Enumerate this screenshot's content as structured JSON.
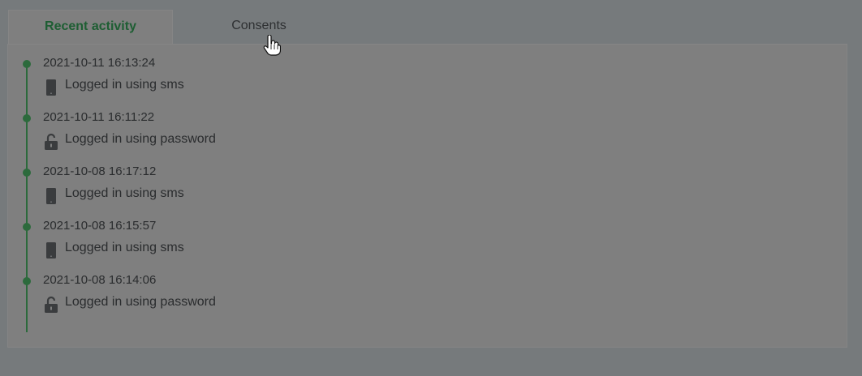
{
  "tabs": [
    {
      "label": "Recent activity",
      "active": true
    },
    {
      "label": "Consents",
      "active": false
    }
  ],
  "activity": [
    {
      "timestamp": "2021-10-11 16:13:24",
      "text": "Logged in using sms",
      "icon": "phone-icon"
    },
    {
      "timestamp": "2021-10-11 16:11:22",
      "text": "Logged in using password",
      "icon": "unlock-icon"
    },
    {
      "timestamp": "2021-10-08 16:17:12",
      "text": "Logged in using sms",
      "icon": "phone-icon"
    },
    {
      "timestamp": "2021-10-08 16:15:57",
      "text": "Logged in using sms",
      "icon": "phone-icon"
    },
    {
      "timestamp": "2021-10-08 16:14:06",
      "text": "Logged in using password",
      "icon": "unlock-icon"
    }
  ],
  "colors": {
    "accent": "#2c6a3c",
    "active_tab_text": "#1e5e33",
    "overlay_bg": "#767a7c"
  }
}
